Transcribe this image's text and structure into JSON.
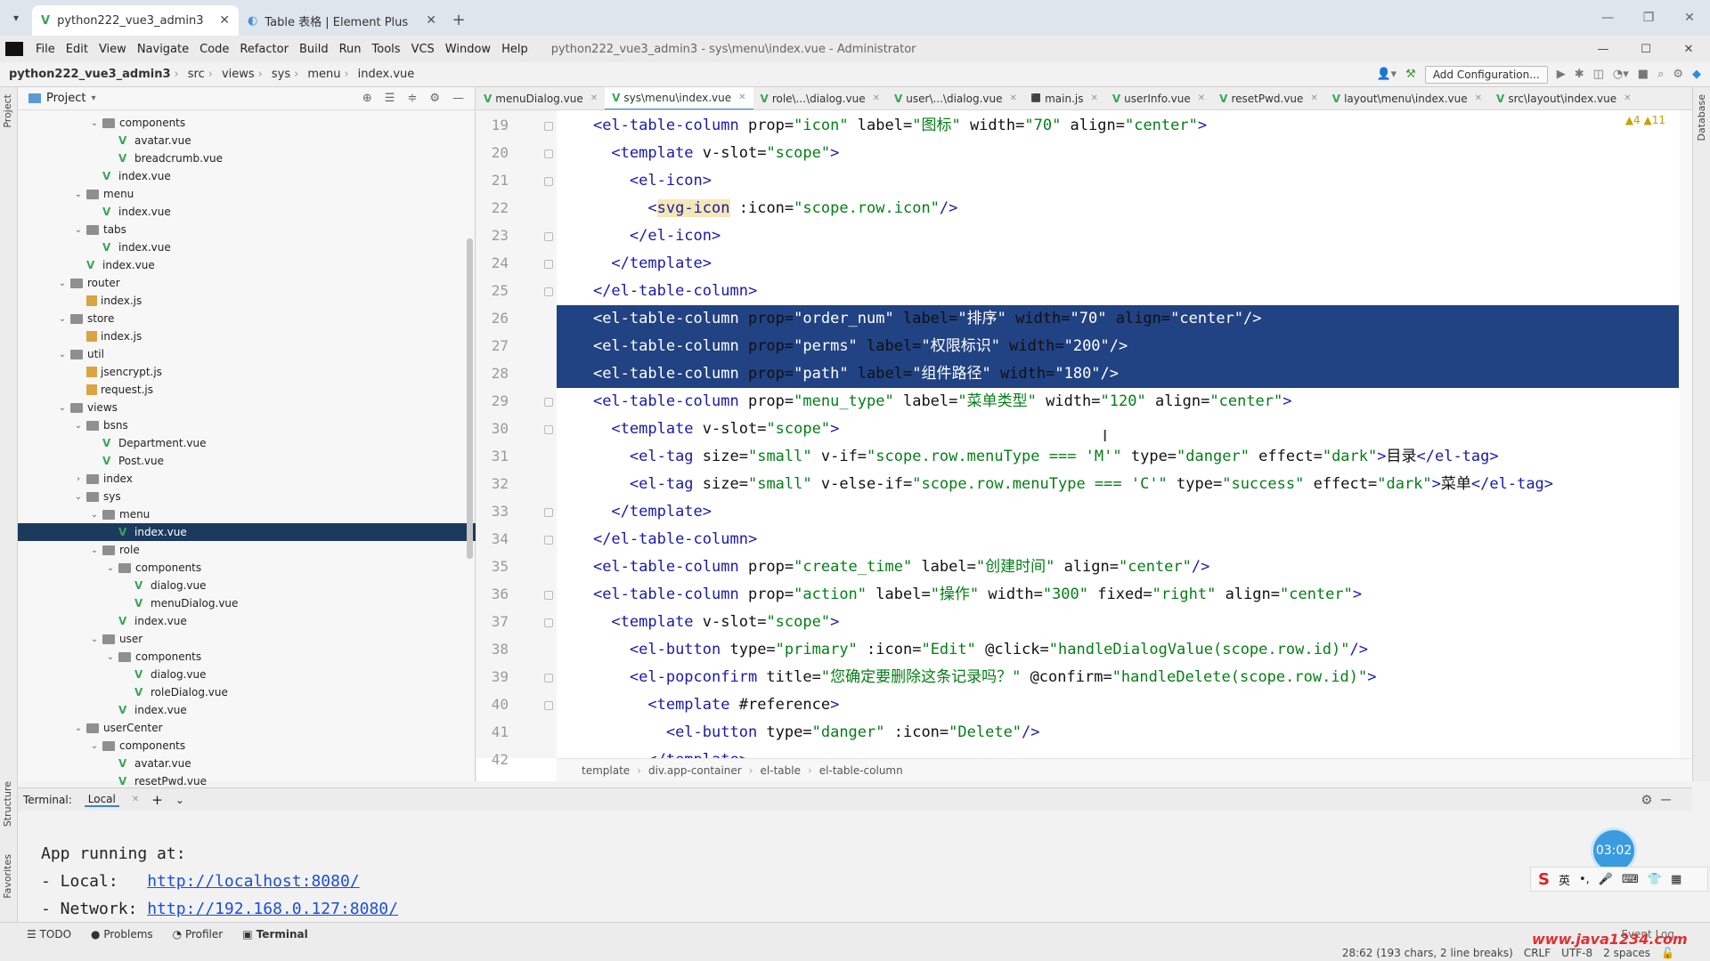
{
  "browser": {
    "tabs": [
      {
        "label": "python222_vue3_admin3",
        "active": true
      },
      {
        "label": "Table 表格 | Element Plus",
        "active": false
      }
    ]
  },
  "menubar": {
    "items": [
      "File",
      "Edit",
      "View",
      "Navigate",
      "Code",
      "Refactor",
      "Build",
      "Run",
      "Tools",
      "VCS",
      "Window",
      "Help"
    ],
    "window_title": "python222_vue3_admin3 - sys\\menu\\index.vue - Administrator"
  },
  "navbar": {
    "crumbs": [
      "python222_vue3_admin3",
      "src",
      "views",
      "sys",
      "menu",
      "index.vue"
    ],
    "add_config": "Add Configuration..."
  },
  "project": {
    "title": "Project",
    "tree": [
      {
        "depth": 5,
        "type": "folder",
        "label": "components",
        "expanded": true
      },
      {
        "depth": 6,
        "type": "vue",
        "label": "avatar.vue"
      },
      {
        "depth": 6,
        "type": "vue",
        "label": "breadcrumb.vue"
      },
      {
        "depth": 5,
        "type": "vue",
        "label": "index.vue"
      },
      {
        "depth": 4,
        "type": "folder",
        "label": "menu",
        "expanded": true
      },
      {
        "depth": 5,
        "type": "vue",
        "label": "index.vue"
      },
      {
        "depth": 4,
        "type": "folder",
        "label": "tabs",
        "expanded": true
      },
      {
        "depth": 5,
        "type": "vue",
        "label": "index.vue"
      },
      {
        "depth": 4,
        "type": "vue",
        "label": "index.vue"
      },
      {
        "depth": 3,
        "type": "folder",
        "label": "router",
        "expanded": true
      },
      {
        "depth": 4,
        "type": "js",
        "label": "index.js"
      },
      {
        "depth": 3,
        "type": "folder",
        "label": "store",
        "expanded": true
      },
      {
        "depth": 4,
        "type": "js",
        "label": "index.js"
      },
      {
        "depth": 3,
        "type": "folder",
        "label": "util",
        "expanded": true
      },
      {
        "depth": 4,
        "type": "js",
        "label": "jsencrypt.js"
      },
      {
        "depth": 4,
        "type": "js",
        "label": "request.js"
      },
      {
        "depth": 3,
        "type": "folder",
        "label": "views",
        "expanded": true
      },
      {
        "depth": 4,
        "type": "folder",
        "label": "bsns",
        "expanded": true
      },
      {
        "depth": 5,
        "type": "vue",
        "label": "Department.vue"
      },
      {
        "depth": 5,
        "type": "vue",
        "label": "Post.vue"
      },
      {
        "depth": 4,
        "type": "folder",
        "label": "index",
        "expanded": false
      },
      {
        "depth": 4,
        "type": "folder",
        "label": "sys",
        "expanded": true
      },
      {
        "depth": 5,
        "type": "folder",
        "label": "menu",
        "expanded": true
      },
      {
        "depth": 6,
        "type": "vue",
        "label": "index.vue",
        "selected": true
      },
      {
        "depth": 5,
        "type": "folder",
        "label": "role",
        "expanded": true
      },
      {
        "depth": 6,
        "type": "folder",
        "label": "components",
        "expanded": true
      },
      {
        "depth": 7,
        "type": "vue",
        "label": "dialog.vue"
      },
      {
        "depth": 7,
        "type": "vue",
        "label": "menuDialog.vue"
      },
      {
        "depth": 6,
        "type": "vue",
        "label": "index.vue"
      },
      {
        "depth": 5,
        "type": "folder",
        "label": "user",
        "expanded": true
      },
      {
        "depth": 6,
        "type": "folder",
        "label": "components",
        "expanded": true
      },
      {
        "depth": 7,
        "type": "vue",
        "label": "dialog.vue"
      },
      {
        "depth": 7,
        "type": "vue",
        "label": "roleDialog.vue"
      },
      {
        "depth": 6,
        "type": "vue",
        "label": "index.vue"
      },
      {
        "depth": 4,
        "type": "folder",
        "label": "userCenter",
        "expanded": true
      },
      {
        "depth": 5,
        "type": "folder",
        "label": "components",
        "expanded": true
      },
      {
        "depth": 6,
        "type": "vue",
        "label": "avatar.vue"
      },
      {
        "depth": 6,
        "type": "vue",
        "label": "resetPwd.vue"
      }
    ]
  },
  "editor": {
    "tabs": [
      {
        "label": "menuDialog.vue",
        "active": false
      },
      {
        "label": "sys\\menu\\index.vue",
        "active": true
      },
      {
        "label": "role\\...\\dialog.vue",
        "active": false
      },
      {
        "label": "user\\...\\dialog.vue",
        "active": false
      },
      {
        "label": "main.js",
        "active": false
      },
      {
        "label": "userInfo.vue",
        "active": false
      },
      {
        "label": "resetPwd.vue",
        "active": false
      },
      {
        "label": "layout\\menu\\index.vue",
        "active": false
      },
      {
        "label": "src\\layout\\index.vue",
        "active": false
      }
    ],
    "warnings": "▲4 ▲11",
    "line_numbers": [
      "19",
      "20",
      "21",
      "22",
      "23",
      "24",
      "25",
      "26",
      "27",
      "28",
      "29",
      "30",
      "31",
      "32",
      "33",
      "34",
      "35",
      "36",
      "37",
      "38",
      "39",
      "40",
      "41",
      "42"
    ],
    "lines": [
      "    <el-table-column prop=\"icon\" label=\"图标\" width=\"70\" align=\"center\">",
      "      <template v-slot=\"scope\">",
      "        <el-icon>",
      "          <svg-icon :icon=\"scope.row.icon\"/>",
      "        </el-icon>",
      "      </template>",
      "    </el-table-column>",
      "    <el-table-column prop=\"order_num\" label=\"排序\" width=\"70\" align=\"center\"/>",
      "    <el-table-column prop=\"perms\" label=\"权限标识\" width=\"200\"/>",
      "    <el-table-column prop=\"path\" label=\"组件路径\" width=\"180\"/>",
      "    <el-table-column prop=\"menu_type\" label=\"菜单类型\" width=\"120\" align=\"center\">",
      "      <template v-slot=\"scope\">",
      "        <el-tag size=\"small\" v-if=\"scope.row.menuType === 'M'\" type=\"danger\" effect=\"dark\">目录</el-tag>",
      "        <el-tag size=\"small\" v-else-if=\"scope.row.menuType === 'C'\" type=\"success\" effect=\"dark\">菜单</el-tag>",
      "      </template>",
      "    </el-table-column>",
      "    <el-table-column prop=\"create_time\" label=\"创建时间\" align=\"center\"/>",
      "    <el-table-column prop=\"action\" label=\"操作\" width=\"300\" fixed=\"right\" align=\"center\">",
      "      <template v-slot=\"scope\">",
      "        <el-button type=\"primary\" :icon=\"Edit\" @click=\"handleDialogValue(scope.row.id)\"/>",
      "        <el-popconfirm title=\"您确定要删除这条记录吗？\" @confirm=\"handleDelete(scope.row.id)\">",
      "          <template #reference>",
      "            <el-button type=\"danger\" :icon=\"Delete\"/>",
      "          </template>"
    ],
    "breadcrumb": [
      "template",
      "div.app-container",
      "el-table",
      "el-table-column"
    ]
  },
  "terminal": {
    "label": "Terminal:",
    "tab": "Local",
    "lines": [
      {
        "text": "App running at:",
        "link": ""
      },
      {
        "text": "- Local:   ",
        "link": "http://localhost:8080/"
      },
      {
        "text": "- Network: ",
        "link": "http://192.168.0.127:8080/"
      }
    ]
  },
  "bottom_tabs": [
    "TODO",
    "Problems",
    "Profiler",
    "Terminal"
  ],
  "event_log": "Event Log",
  "status": {
    "position": "28:62 (193 chars, 2 line breaks)",
    "line_sep": "CRLF",
    "encoding": "UTF-8",
    "indent": "2 spaces"
  },
  "overlay": {
    "timer": "03:02",
    "ime_mode": "英",
    "watermark": "www.java1234.com"
  },
  "side_labels": {
    "project": "Project",
    "structure": "Structure",
    "favorites": "Favorites",
    "database": "Database"
  }
}
